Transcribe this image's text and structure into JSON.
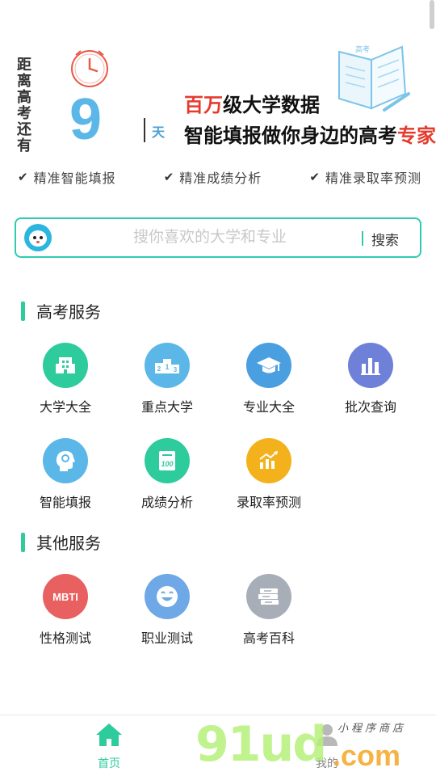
{
  "header": {
    "countdown_label": "距离高考还有",
    "days": "9",
    "days_unit": "天",
    "headline1_red": "百万",
    "headline1_rest": "级大学数据",
    "headline2_main": "智能填报做你身边的高考",
    "headline2_red": "专家",
    "book_text": "高考"
  },
  "features": [
    {
      "label": "精准智能填报"
    },
    {
      "label": "精准成绩分析"
    },
    {
      "label": "精准录取率预测"
    }
  ],
  "search": {
    "placeholder": "搜你喜欢的大学和专业",
    "button": "搜索"
  },
  "sections": {
    "gaokao": {
      "title": "高考服务",
      "items": [
        {
          "label": "大学大全",
          "icon": "building-icon",
          "color": "#2ecb9d"
        },
        {
          "label": "重点大学",
          "icon": "podium-icon",
          "color": "#5bb7e8"
        },
        {
          "label": "专业大全",
          "icon": "graduation-cap-icon",
          "color": "#4a9fe0"
        },
        {
          "label": "批次查询",
          "icon": "bar-chart-icon",
          "color": "#6f80d8"
        },
        {
          "label": "智能填报",
          "icon": "brain-head-icon",
          "color": "#5bb7e8"
        },
        {
          "label": "成绩分析",
          "icon": "score-sheet-icon",
          "color": "#2ecb9d"
        },
        {
          "label": "录取率预测",
          "icon": "trend-chart-icon",
          "color": "#f3b21b"
        }
      ]
    },
    "other": {
      "title": "其他服务",
      "items": [
        {
          "label": "性格测试",
          "icon": "mbti-icon",
          "badge": "MBTI",
          "color": "#e86060"
        },
        {
          "label": "职业测试",
          "icon": "smile-face-icon",
          "color": "#6fa8e6"
        },
        {
          "label": "高考百科",
          "icon": "books-stack-icon",
          "color": "#a8aeb8"
        }
      ]
    }
  },
  "tabbar": {
    "home": "首页",
    "mine": "我的",
    "accent": "#2ecb9d"
  },
  "watermark": {
    "brand": "91ud.com",
    "tagline": "小程序商店"
  }
}
